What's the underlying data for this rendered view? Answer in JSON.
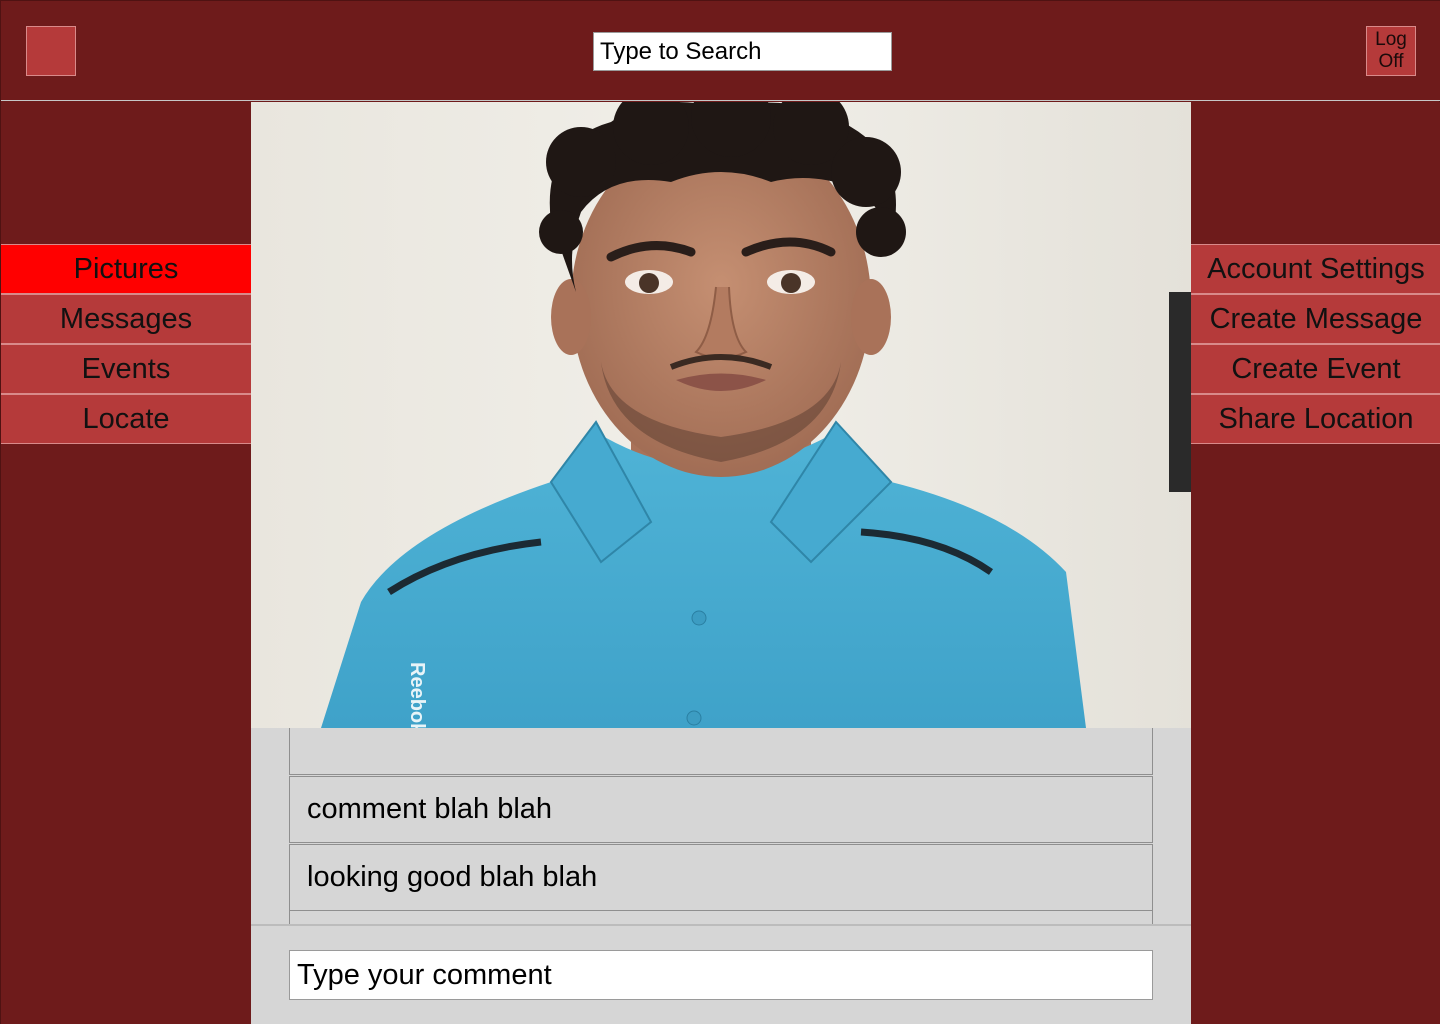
{
  "header": {
    "search": {
      "placeholder": "Type to Search"
    },
    "logoff_label": "Log\nOff"
  },
  "left_menu": {
    "items": [
      {
        "label": "Pictures",
        "active": true
      },
      {
        "label": "Messages",
        "active": false
      },
      {
        "label": "Events",
        "active": false
      },
      {
        "label": "Locate",
        "active": false
      }
    ]
  },
  "right_menu": {
    "items": [
      {
        "label": "Account Settings"
      },
      {
        "label": "Create Message"
      },
      {
        "label": "Create Event"
      },
      {
        "label": "Share Location"
      }
    ]
  },
  "photo": {
    "shirt_logo_text": "Reebok"
  },
  "comments": {
    "items": [
      {
        "text": ""
      },
      {
        "text": "comment blah blah"
      },
      {
        "text": "looking good blah blah"
      },
      {
        "text": ""
      }
    ],
    "input": {
      "placeholder": "Type your comment"
    }
  },
  "colors": {
    "background": "#6e1b1b",
    "menu_item": "#b53a3a",
    "menu_active": "#ff0000",
    "comment_panel": "#d6d6d6"
  }
}
